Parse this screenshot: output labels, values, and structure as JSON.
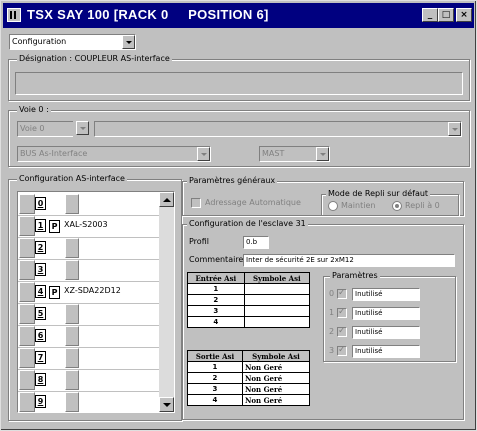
{
  "title": "TSX SAY 100 [RACK 0     POSITION 6]",
  "window_buttons": {
    "min": "_",
    "max": "□",
    "close": "×"
  },
  "mode_select": {
    "value": "Configuration"
  },
  "designation": {
    "label": "Désignation : COUPLEUR AS-interface"
  },
  "voie": {
    "label": "Voie 0 :",
    "channel_value": "Voie 0",
    "bus_value": "BUS As-Interface",
    "task_value": "MAST"
  },
  "config_asi": {
    "label": "Configuration AS-interface",
    "slots": [
      {
        "num": "0",
        "p": "",
        "ref": ""
      },
      {
        "num": "1",
        "p": "P",
        "ref": "XAL-S2003"
      },
      {
        "num": "2",
        "p": "",
        "ref": ""
      },
      {
        "num": "3",
        "p": "",
        "ref": ""
      },
      {
        "num": "4",
        "p": "P",
        "ref": "XZ-SDA22D12"
      },
      {
        "num": "5",
        "p": "",
        "ref": ""
      },
      {
        "num": "6",
        "p": "",
        "ref": ""
      },
      {
        "num": "7",
        "p": "",
        "ref": ""
      },
      {
        "num": "8",
        "p": "",
        "ref": ""
      },
      {
        "num": "9",
        "p": "",
        "ref": ""
      }
    ]
  },
  "general": {
    "label": "Paramètres généraux",
    "auto_address": "Adressage Automatique",
    "repli_label": "Mode de Repli sur défaut",
    "maintien": "Maintien",
    "repli0": "Repli à 0"
  },
  "slave": {
    "label": "Configuration de l'esclave 31",
    "profil_label": "Profil",
    "profil_value": "0.b",
    "comment_label": "Commentaire",
    "comment_value": "Inter de sécurité 2E sur 2xM12",
    "inputs": {
      "headers": [
        "Entrée Asi",
        "Symbole Asi"
      ],
      "rows": [
        {
          "n": "1",
          "s": ""
        },
        {
          "n": "2",
          "s": ""
        },
        {
          "n": "3",
          "s": ""
        },
        {
          "n": "4",
          "s": ""
        }
      ]
    },
    "outputs": {
      "headers": [
        "Sortie Asi",
        "Symbole Asi"
      ],
      "rows": [
        {
          "n": "1",
          "s": "Non Geré"
        },
        {
          "n": "2",
          "s": "Non Geré"
        },
        {
          "n": "3",
          "s": "Non Geré"
        },
        {
          "n": "4",
          "s": "Non Geré"
        }
      ]
    },
    "params": {
      "label": "Paramètres",
      "rows": [
        {
          "n": "0",
          "v": "Inutilisé"
        },
        {
          "n": "1",
          "v": "Inutilisé"
        },
        {
          "n": "2",
          "v": "Inutilisé"
        },
        {
          "n": "3",
          "v": "Inutilisé"
        }
      ]
    }
  }
}
